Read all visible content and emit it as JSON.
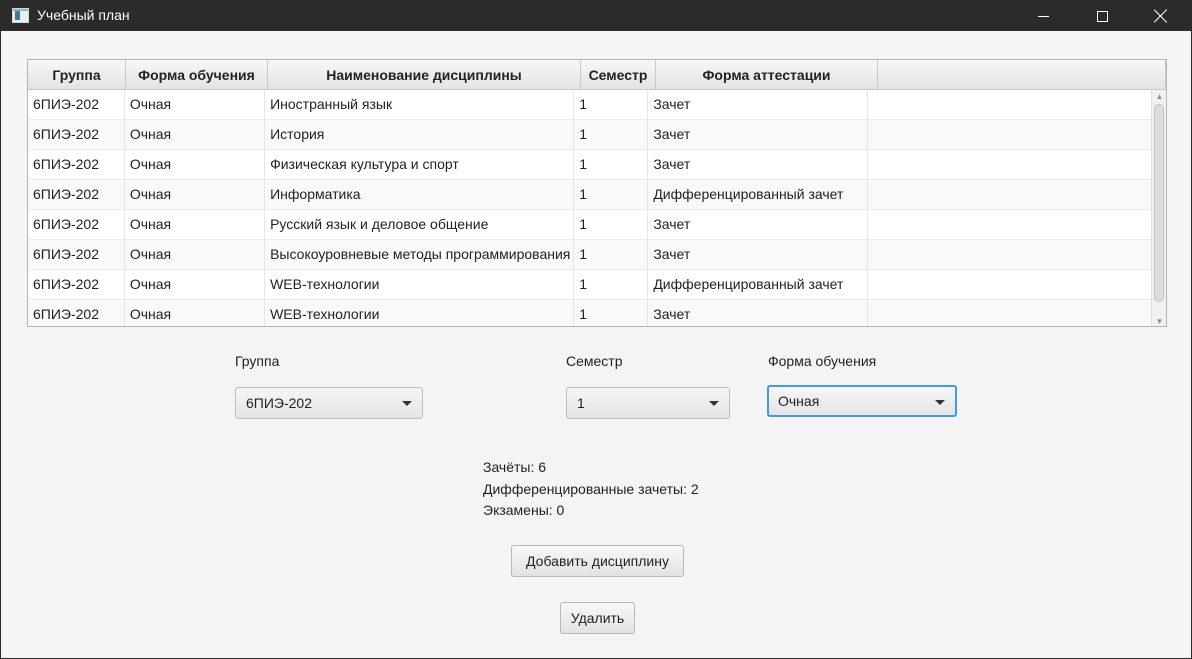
{
  "window": {
    "title": "Учебный план"
  },
  "table": {
    "columns": [
      "Группа",
      "Форма обучения",
      "Наименование дисциплины",
      "Семестр",
      "Форма аттестации",
      ""
    ],
    "rows": [
      [
        "6ПИЭ-202",
        "Очная",
        "Иностранный язык",
        "1",
        "Зачет"
      ],
      [
        "6ПИЭ-202",
        "Очная",
        "История",
        "1",
        "Зачет"
      ],
      [
        "6ПИЭ-202",
        "Очная",
        "Физическая культура и спорт",
        "1",
        "Зачет"
      ],
      [
        "6ПИЭ-202",
        "Очная",
        "Информатика",
        "1",
        "Дифференцированный зачет"
      ],
      [
        "6ПИЭ-202",
        "Очная",
        "Русский язык и деловое общение",
        "1",
        "Зачет"
      ],
      [
        "6ПИЭ-202",
        "Очная",
        "Высокоуровневые методы программирования",
        "1",
        "Зачет"
      ],
      [
        "6ПИЭ-202",
        "Очная",
        "WEB-технологии",
        "1",
        "Дифференцированный зачет"
      ],
      [
        "6ПИЭ-202",
        "Очная",
        "WEB-технологии",
        "1",
        "Зачет"
      ]
    ]
  },
  "filters": {
    "group": {
      "label": "Группа",
      "value": "6ПИЭ-202"
    },
    "semester": {
      "label": "Семестр",
      "value": "1"
    },
    "study_form": {
      "label": "Форма обучения",
      "value": "Очная"
    }
  },
  "stats": {
    "credits": "Зачёты: 6",
    "diff_credits": "Дифференцированные зачеты: 2",
    "exams": "Экзамены: 0"
  },
  "buttons": {
    "add": "Добавить дисциплину",
    "delete": "Удалить"
  },
  "colors": {
    "titlebar": "#2b2b2b",
    "focus_accent": "#3d9be9",
    "background": "#f4f4f4"
  },
  "icons": {
    "window": [
      "app-icon",
      "minimize-icon",
      "maximize-icon",
      "close-icon"
    ],
    "dropdown": "chevron-down-icon"
  }
}
